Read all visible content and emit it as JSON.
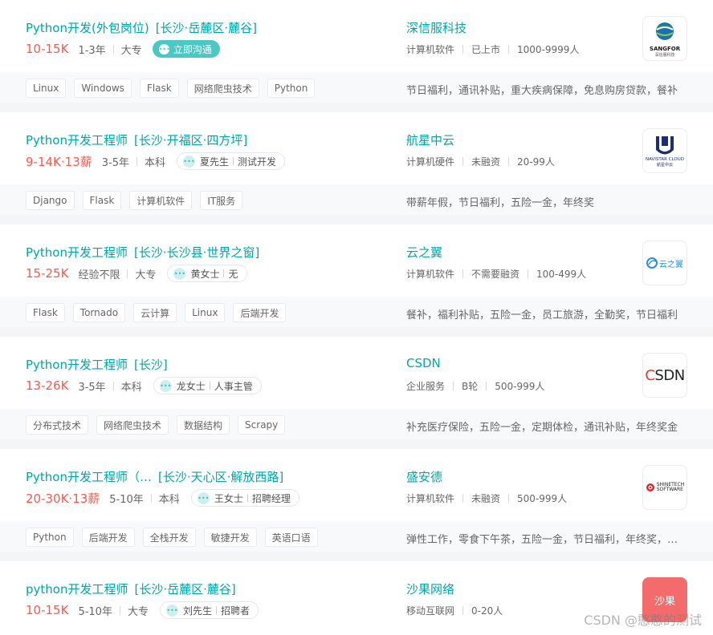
{
  "chat_button_label": "立即沟通",
  "jobs": [
    {
      "title": "Python开发(外包岗位)",
      "location": "[长沙·岳麓区·麓谷]",
      "salary": "10-15K",
      "experience": "1-3年",
      "education": "大专",
      "recruiter_name": "",
      "recruiter_role": "",
      "skills": [
        "Linux",
        "Windows",
        "Flask",
        "网络爬虫技术",
        "Python"
      ],
      "welfare": "节日福利，通讯补贴，重大疾病保障，免息购房贷款，餐补",
      "company": {
        "name": "深信服科技",
        "industry": "计算机软件",
        "stage": "已上市",
        "size": "1000-9999人",
        "logo_text": "SANGFOR",
        "logo_sub": "深信服科技",
        "logo_icon": "globe-icon"
      }
    },
    {
      "title": "Python开发工程师",
      "location": "[长沙·开福区·四方坪]",
      "salary": "9-14K·13薪",
      "experience": "3-5年",
      "education": "本科",
      "recruiter_name": "夏先生",
      "recruiter_role": "测试开发",
      "skills": [
        "Django",
        "Flask",
        "计算机软件",
        "IT服务"
      ],
      "welfare": "带薪年假，节日福利，五险一金，年终奖",
      "company": {
        "name": "航星中云",
        "industry": "计算机硬件",
        "stage": "未融资",
        "size": "20-99人",
        "logo_text": "NAVISTAR CLOUD",
        "logo_sub": "航星中云",
        "logo_icon": "shield-icon"
      }
    },
    {
      "title": "Python开发工程师",
      "location": "[长沙·长沙县·世界之窗]",
      "salary": "15-25K",
      "experience": "经验不限",
      "education": "大专",
      "recruiter_name": "黄女士",
      "recruiter_role": "无",
      "skills": [
        "Flask",
        "Tornado",
        "云计算",
        "Linux",
        "后端开发"
      ],
      "welfare": "餐补，福利补贴，五险一金，员工旅游，全勤奖，节日福利",
      "company": {
        "name": "云之翼",
        "industry": "计算机软件",
        "stage": "不需要融资",
        "size": "100-499人",
        "logo_text": "云之翼",
        "logo_sub": "",
        "logo_icon": "wing-icon"
      }
    },
    {
      "title": "Python开发工程师",
      "location": "[长沙]",
      "salary": "13-26K",
      "experience": "3-5年",
      "education": "本科",
      "recruiter_name": "龙女士",
      "recruiter_role": "人事主管",
      "skills": [
        "分布式技术",
        "网络爬虫技术",
        "数据结构",
        "Scrapy"
      ],
      "welfare": "补充医疗保险，五险一金，定期体检，通讯补贴，年终奖金",
      "company": {
        "name": "CSDN",
        "industry": "企业服务",
        "stage": "B轮",
        "size": "500-999人",
        "logo_text": "CSDN",
        "logo_sub": "",
        "logo_icon": "csdn-logo-icon"
      }
    },
    {
      "title": "Python开发工程师（…",
      "location": "[长沙·天心区·解放西路]",
      "salary": "20-30K·13薪",
      "experience": "5-10年",
      "education": "本科",
      "recruiter_name": "王女士",
      "recruiter_role": "招聘经理",
      "skills": [
        "Python",
        "后端开发",
        "全栈开发",
        "敏捷开发",
        "英语口语"
      ],
      "welfare": "弹性工作，零食下午茶，五险一金，节日福利，年终奖，加班补助",
      "company": {
        "name": "盛安德",
        "industry": "计算机软件",
        "stage": "未融资",
        "size": "500-999人",
        "logo_text": "SHINETECH",
        "logo_sub": "SOFTWARE",
        "logo_icon": "target-icon"
      }
    },
    {
      "title": "python开发工程师",
      "location": "[长沙·岳麓区·麓谷]",
      "salary": "10-15K",
      "experience": "5-10年",
      "education": "大专",
      "recruiter_name": "刘先生",
      "recruiter_role": "招聘者",
      "skills": [],
      "welfare": "",
      "company": {
        "name": "沙果网络",
        "industry": "移动互联网",
        "stage": "0-20人",
        "size": "",
        "logo_text": "沙果",
        "logo_sub": "",
        "logo_icon": "text-badge-icon"
      }
    }
  ],
  "watermark": "CSDN @憨憨的测试",
  "colors": {
    "accent": "#00a6a7",
    "salary": "#fe574a",
    "chat": "#4ac9c4",
    "logo_red_badge": "#f36b6b"
  }
}
